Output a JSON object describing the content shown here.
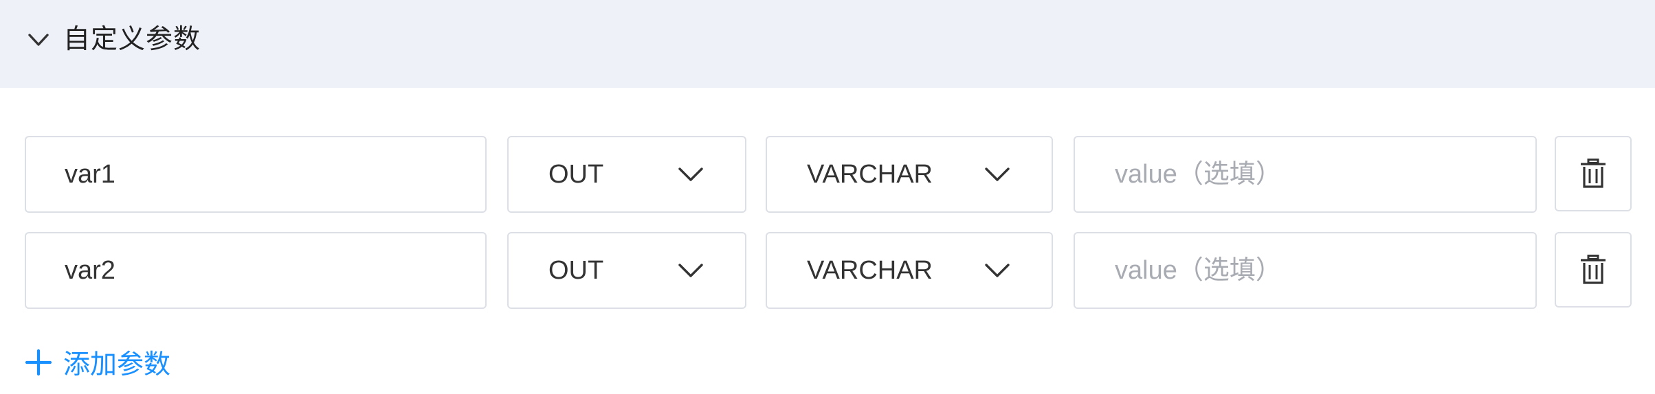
{
  "section": {
    "title": "自定义参数",
    "collapse_icon": "chevron-down-icon"
  },
  "rows": [
    {
      "name": "var1",
      "direction": "OUT",
      "type": "VARCHAR",
      "value": "",
      "value_placeholder": "value（选填）",
      "delete_icon": "trash-icon"
    },
    {
      "name": "var2",
      "direction": "OUT",
      "type": "VARCHAR",
      "value": "",
      "value_placeholder": "value（选填）",
      "delete_icon": "trash-icon"
    }
  ],
  "add_button": {
    "label": "添加参数",
    "icon": "plus-icon"
  },
  "colors": {
    "header_bg": "#eef1f8",
    "border": "#dcdfe6",
    "placeholder": "#a8abb2",
    "accent": "#1890ff"
  }
}
